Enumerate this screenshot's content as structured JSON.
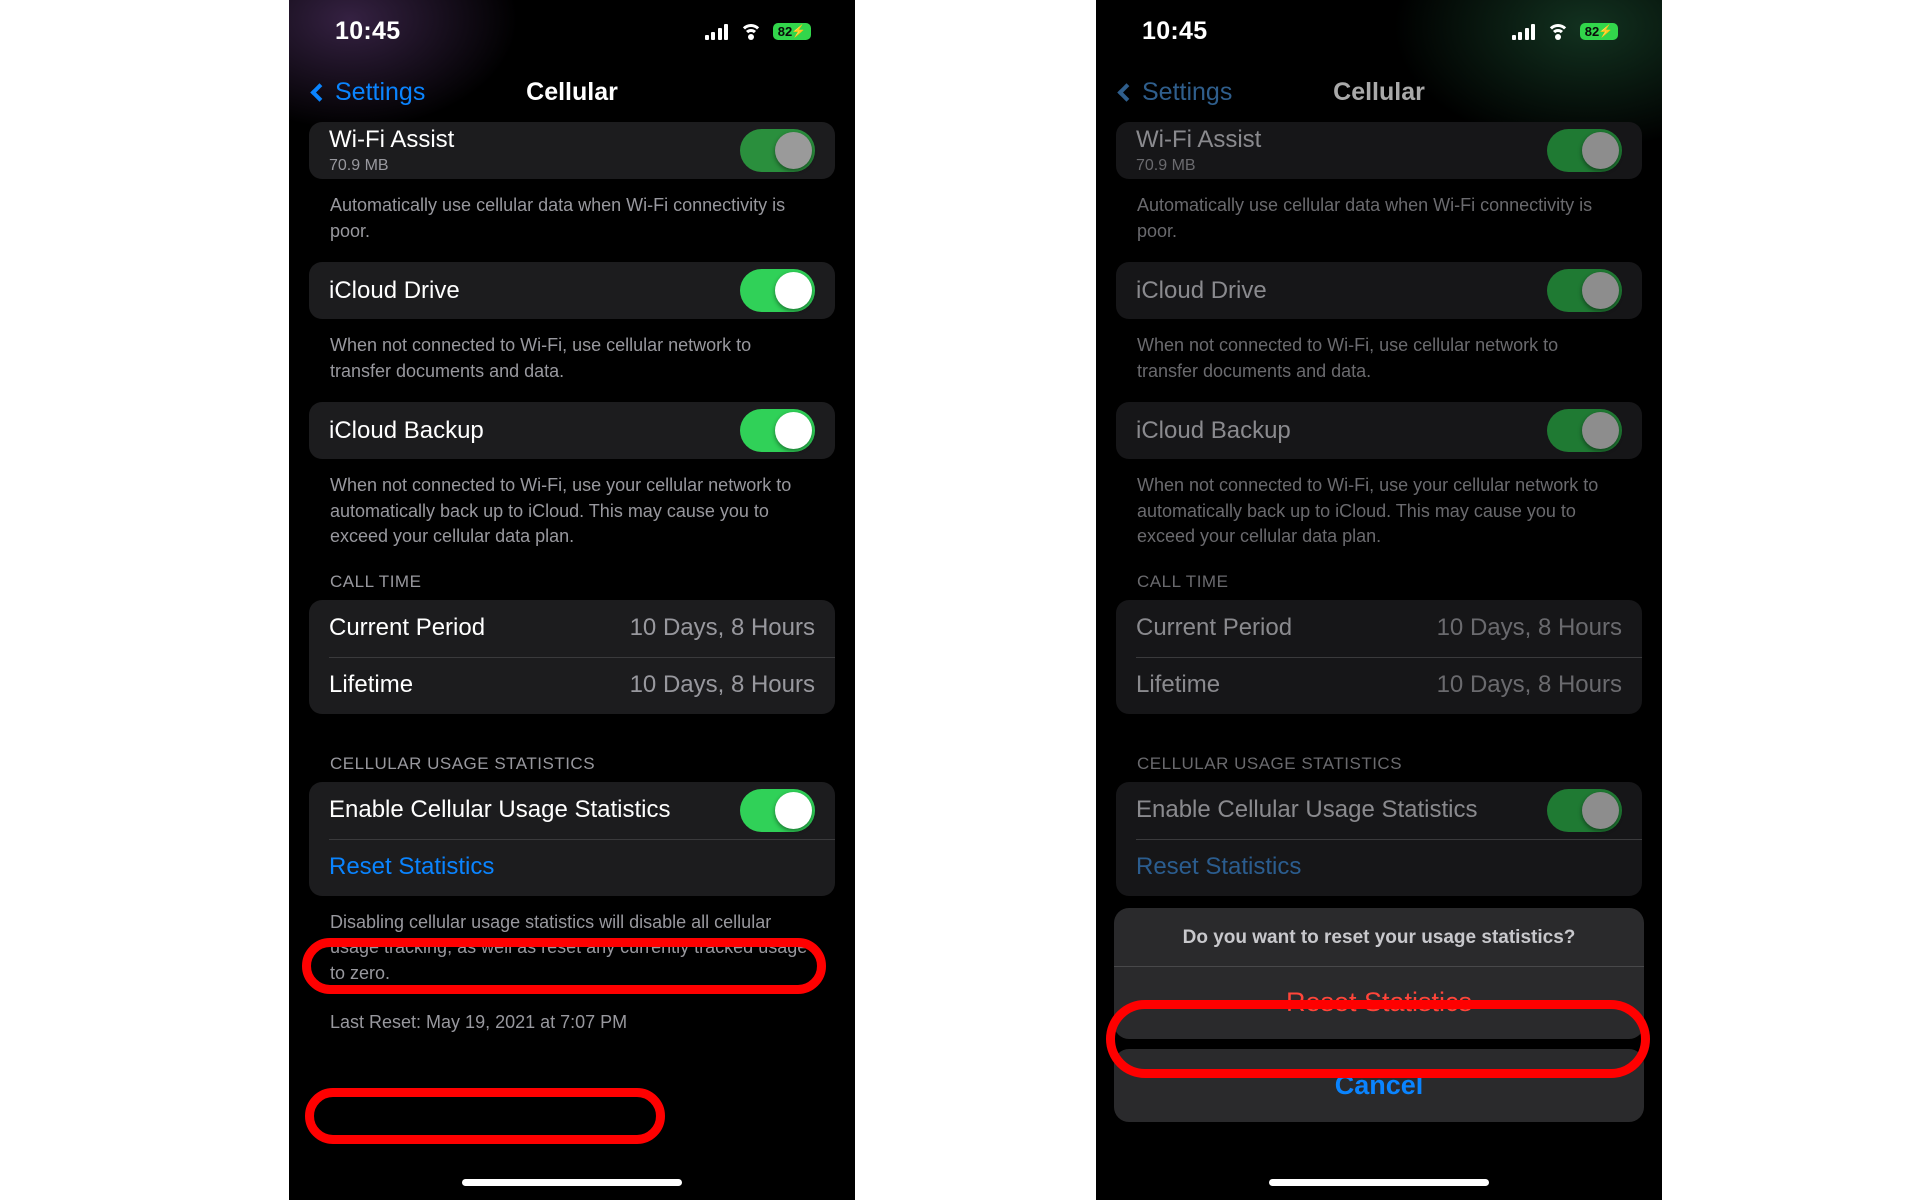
{
  "status_bar": {
    "time": "10:45",
    "signal_icon": "cellular-signal-icon",
    "wifi_icon": "wifi-icon",
    "battery_level": "82",
    "battery_charging_glyph": "⚡",
    "battery_color": "#32D64B"
  },
  "nav": {
    "back_label": "Settings",
    "title": "Cellular",
    "tint_color": "#0A84FF"
  },
  "settings": {
    "wifi_assist": {
      "label": "Wi-Fi Assist",
      "sub": "70.9 MB",
      "toggle_on": true
    },
    "wifi_assist_footnote": "Automatically use cellular data when Wi-Fi connectivity is poor.",
    "icloud_drive": {
      "label": "iCloud Drive",
      "toggle_on": true
    },
    "icloud_drive_footnote": "When not connected to Wi-Fi, use cellular network to transfer documents and data.",
    "icloud_backup": {
      "label": "iCloud Backup",
      "toggle_on": true
    },
    "icloud_backup_footnote": "When not connected to Wi-Fi, use your cellular network to automatically back up to iCloud. This may cause you to exceed your cellular data plan.",
    "call_time_header": "CALL TIME",
    "call_time_rows": [
      {
        "label": "Current Period",
        "value": "10 Days, 8 Hours"
      },
      {
        "label": "Lifetime",
        "value": "10 Days, 8 Hours"
      }
    ],
    "usage_stats_header": "CELLULAR USAGE STATISTICS",
    "enable_usage_stats": {
      "label": "Enable Cellular Usage Statistics",
      "toggle_on": true
    },
    "reset_statistics_label": "Reset Statistics",
    "reset_footnote": "Disabling cellular usage statistics will disable all cellular usage tracking, as well as reset any currently tracked usage to zero.",
    "last_reset": "Last Reset: May 19, 2021 at 7:07 PM"
  },
  "action_sheet": {
    "title": "Do you want to reset your usage statistics?",
    "destructive_label": "Reset Statistics",
    "destructive_color": "#FF453A",
    "cancel_label": "Cancel",
    "cancel_color": "#0A84FF"
  },
  "annotations": {
    "highlight_color": "#FF0000",
    "count": 3
  }
}
